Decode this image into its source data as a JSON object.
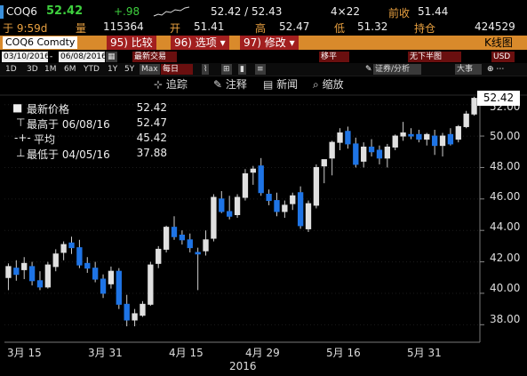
{
  "header": {
    "ticker": "COQ6",
    "last": "52.42",
    "change": "+.98",
    "bid_ask": "52.42 / 52.43",
    "size": "4×22",
    "prev_close_label": "前收",
    "prev_close": "51.44",
    "time_label": "于 9:59d",
    "volume_label": "量",
    "volume": "115364",
    "open_label": "开",
    "open": "51.41",
    "high_label": "高",
    "high": "52.47",
    "low_label": "低",
    "low": "51.32",
    "oi_label": "持仓",
    "oi": "424529"
  },
  "function_bar": {
    "security": "COQ6 Comdty",
    "compare_num": "95)",
    "compare": "比较",
    "options_num": "96)",
    "options": "选项",
    "edit_num": "97)",
    "edit": "修改",
    "title": "K线图"
  },
  "controls": {
    "start_date": "03/10/2016",
    "end_date": "06/08/2016",
    "trade_type": "最新交易",
    "frequency": "每日",
    "smooth": "移平",
    "analysis": "证券/分析",
    "big": "大事",
    "period_sel": "无下半图",
    "currency": "USD",
    "periods": [
      "1D",
      "3D",
      "1M",
      "6M",
      "YTD",
      "1Y",
      "5Y",
      "Max"
    ],
    "selected_period": "Max"
  },
  "chart_toolbar": {
    "track": "追踪",
    "annotate": "注释",
    "news": "新闻",
    "zoom": "缩放"
  },
  "legend": {
    "last_label": "最新价格",
    "last_value": "52.42",
    "high_label": "最高于 06/08/16",
    "high_value": "52.47",
    "avg_label": "平均",
    "avg_value": "45.42",
    "low_label": "最低于 04/05/16",
    "low_value": "37.88"
  },
  "colors": {
    "up": "#e0e0e0",
    "down": "#1e74e6",
    "accent": "#d98a2b",
    "ticker_green": "#3ecf3e"
  },
  "chart_data": {
    "type": "candlestick",
    "ylim": [
      37,
      53
    ],
    "yticks": [
      "52.00",
      "50.00",
      "48.00",
      "46.00",
      "44.00",
      "42.00",
      "40.00",
      "38.00"
    ],
    "xticks": [
      "3月 15",
      "3月 31",
      "4月 15",
      "4月 29",
      "5月 16",
      "5月 31"
    ],
    "year": "2016",
    "last_value": "52.42",
    "candles": [
      [
        41.0,
        41.9,
        40.2,
        41.7
      ],
      [
        41.6,
        42.1,
        40.8,
        41.2
      ],
      [
        41.5,
        42.3,
        40.9,
        41.9
      ],
      [
        41.7,
        42.0,
        40.5,
        40.8
      ],
      [
        40.8,
        41.4,
        40.2,
        40.4
      ],
      [
        40.4,
        42.0,
        40.3,
        41.8
      ],
      [
        41.7,
        42.8,
        41.4,
        42.5
      ],
      [
        42.6,
        43.3,
        42.1,
        43.1
      ],
      [
        43.2,
        43.6,
        42.5,
        42.9
      ],
      [
        42.9,
        43.4,
        41.6,
        41.8
      ],
      [
        41.9,
        42.3,
        41.3,
        41.6
      ],
      [
        41.6,
        42.0,
        40.7,
        40.9
      ],
      [
        40.9,
        41.2,
        39.7,
        40.0
      ],
      [
        40.6,
        41.7,
        40.3,
        41.4
      ],
      [
        41.4,
        41.6,
        39.0,
        39.3
      ],
      [
        39.3,
        39.9,
        37.9,
        38.3
      ],
      [
        38.3,
        39.0,
        37.9,
        38.7
      ],
      [
        38.6,
        39.5,
        38.5,
        39.3
      ],
      [
        39.3,
        42.0,
        39.2,
        41.8
      ],
      [
        41.9,
        43.0,
        41.6,
        42.8
      ],
      [
        42.8,
        44.3,
        42.6,
        44.2
      ],
      [
        44.2,
        44.9,
        43.4,
        43.6
      ],
      [
        43.7,
        44.0,
        43.1,
        43.4
      ],
      [
        43.4,
        43.8,
        42.6,
        42.9
      ],
      [
        42.6,
        42.9,
        40.2,
        42.5
      ],
      [
        42.7,
        44.0,
        42.4,
        43.4
      ],
      [
        43.5,
        46.3,
        43.3,
        46.1
      ],
      [
        46.0,
        46.5,
        45.1,
        45.2
      ],
      [
        45.2,
        46.2,
        44.7,
        44.9
      ],
      [
        45.0,
        46.3,
        44.8,
        46.1
      ],
      [
        46.1,
        47.9,
        45.9,
        47.6
      ],
      [
        47.7,
        48.1,
        46.9,
        47.9
      ],
      [
        48.1,
        48.6,
        46.2,
        46.4
      ],
      [
        46.3,
        46.6,
        45.6,
        45.9
      ],
      [
        45.9,
        46.4,
        44.9,
        45.2
      ],
      [
        45.2,
        45.9,
        44.8,
        45.6
      ],
      [
        45.7,
        46.4,
        45.3,
        46.2
      ],
      [
        46.4,
        46.8,
        44.1,
        44.3
      ],
      [
        44.1,
        45.9,
        43.9,
        45.7
      ],
      [
        45.6,
        48.2,
        45.4,
        48.0
      ],
      [
        48.1,
        48.5,
        47.0,
        48.5
      ],
      [
        48.6,
        49.7,
        47.5,
        49.6
      ],
      [
        49.6,
        50.5,
        49.1,
        50.2
      ],
      [
        50.3,
        50.6,
        49.2,
        49.5
      ],
      [
        49.5,
        49.9,
        48.0,
        48.2
      ],
      [
        48.4,
        49.6,
        48.0,
        49.3
      ],
      [
        49.3,
        49.8,
        48.7,
        49.0
      ],
      [
        49.1,
        49.4,
        48.2,
        48.6
      ],
      [
        48.6,
        49.5,
        48.0,
        49.3
      ],
      [
        49.3,
        50.1,
        49.1,
        50.0
      ],
      [
        50.0,
        50.9,
        49.7,
        50.2
      ],
      [
        50.1,
        50.5,
        49.8,
        50.0
      ],
      [
        50.1,
        50.4,
        49.6,
        49.8
      ],
      [
        49.8,
        50.2,
        49.4,
        50.1
      ],
      [
        50.0,
        50.4,
        48.8,
        49.4
      ],
      [
        49.4,
        50.2,
        48.7,
        50.0
      ],
      [
        50.1,
        50.5,
        49.4,
        49.5
      ],
      [
        49.8,
        50.7,
        49.6,
        50.6
      ],
      [
        50.6,
        51.6,
        50.5,
        51.4
      ],
      [
        51.4,
        52.5,
        51.3,
        52.4
      ]
    ]
  }
}
